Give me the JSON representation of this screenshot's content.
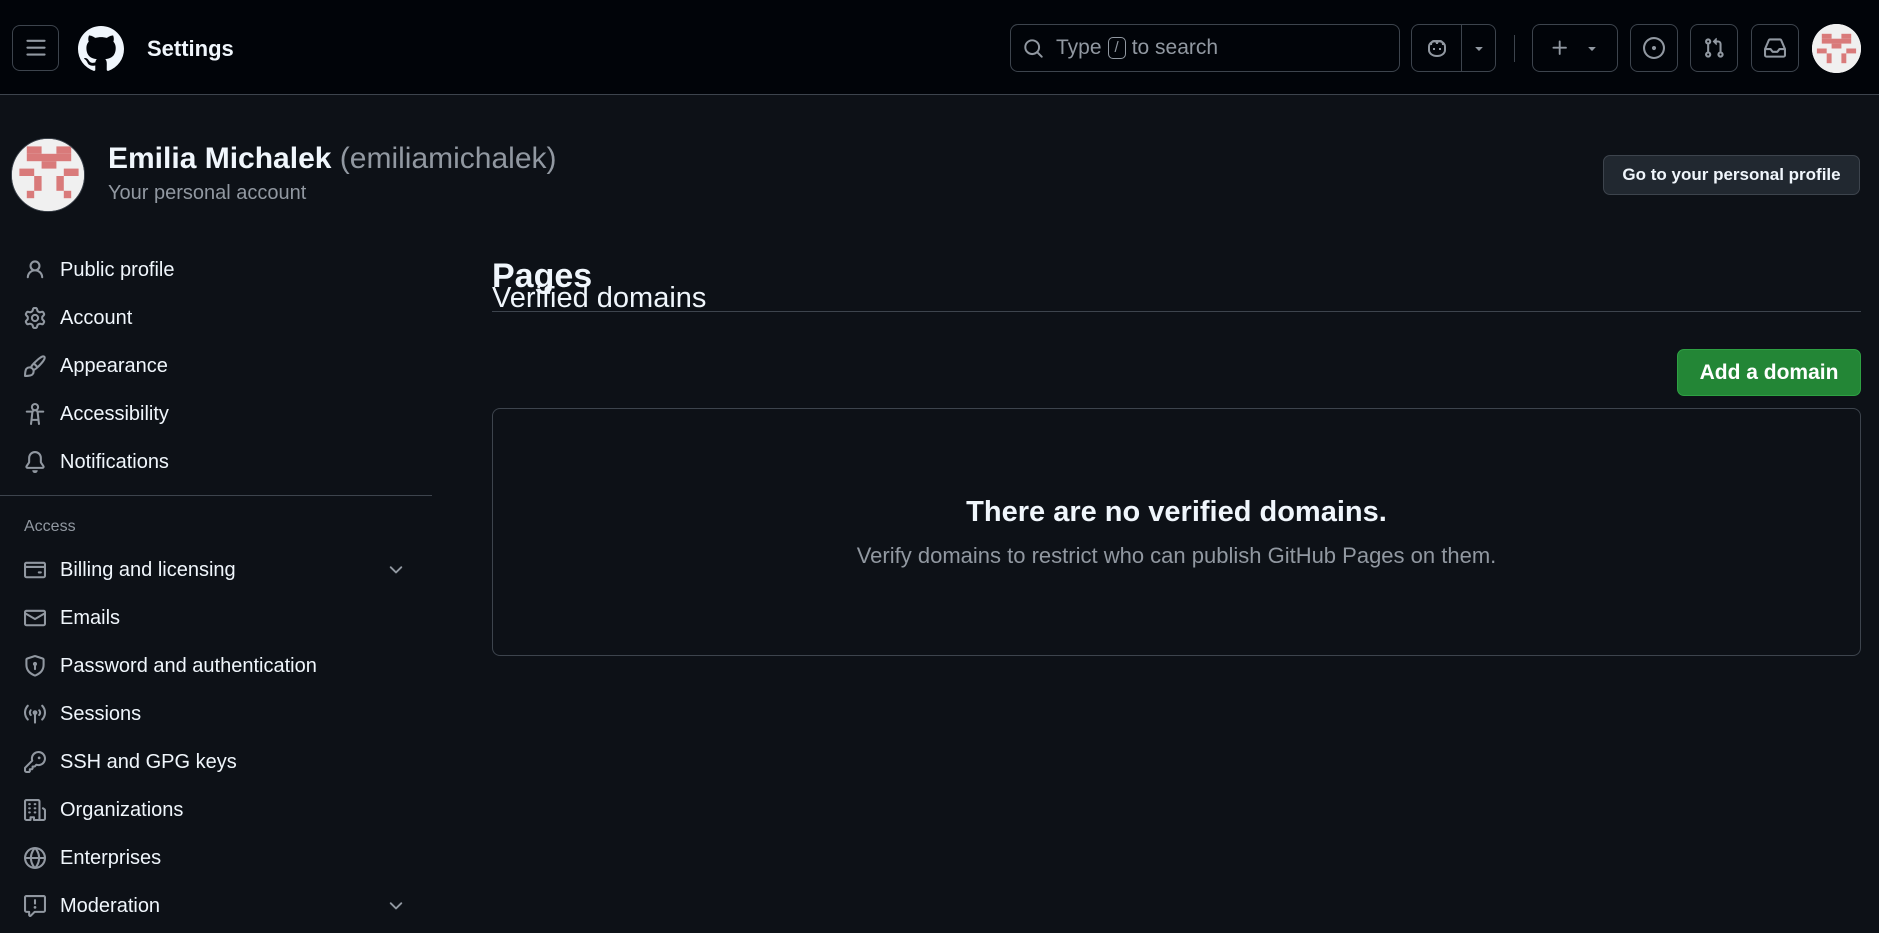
{
  "header": {
    "title": "Settings",
    "search": {
      "prefix": "Type",
      "kbd": "/",
      "suffix": "to search"
    },
    "icons": {
      "menu": "hamburger-icon",
      "logo": "github-logo-icon",
      "search": "search-icon",
      "copilot": "copilot-icon",
      "plus": "plus-icon",
      "issues": "issue-opened-icon",
      "pulls": "git-pull-request-icon",
      "inbox": "inbox-icon"
    }
  },
  "profile": {
    "name": "Emilia Michalek",
    "handle": "(emiliamichalek)",
    "subtitle": "Your personal account",
    "goto_label": "Go to your personal profile"
  },
  "sidebar": {
    "items": [
      {
        "label": "Public profile",
        "icon": "person-icon"
      },
      {
        "label": "Account",
        "icon": "gear-icon"
      },
      {
        "label": "Appearance",
        "icon": "paintbrush-icon"
      },
      {
        "label": "Accessibility",
        "icon": "accessibility-icon"
      },
      {
        "label": "Notifications",
        "icon": "bell-icon"
      }
    ],
    "access_heading": "Access",
    "access_items": [
      {
        "label": "Billing and licensing",
        "icon": "credit-card-icon",
        "expandable": true
      },
      {
        "label": "Emails",
        "icon": "mail-icon"
      },
      {
        "label": "Password and authentication",
        "icon": "shield-lock-icon"
      },
      {
        "label": "Sessions",
        "icon": "broadcast-icon"
      },
      {
        "label": "SSH and GPG keys",
        "icon": "key-icon"
      },
      {
        "label": "Organizations",
        "icon": "organization-icon"
      },
      {
        "label": "Enterprises",
        "icon": "globe-icon"
      },
      {
        "label": "Moderation",
        "icon": "report-icon",
        "expandable": true
      }
    ]
  },
  "main": {
    "page_title": "Pages",
    "section_title": "Verified domains",
    "add_domain_label": "Add a domain",
    "empty_title": "There are no verified domains.",
    "empty_desc": "Verify domains to restrict who can publish GitHub Pages on them."
  },
  "colors": {
    "background": "#0d1117",
    "header_bg": "#010409",
    "border": "#3d444d",
    "muted_text": "#9198a1",
    "primary_button": "#238636",
    "avatar_pink": "#d97a7a"
  }
}
